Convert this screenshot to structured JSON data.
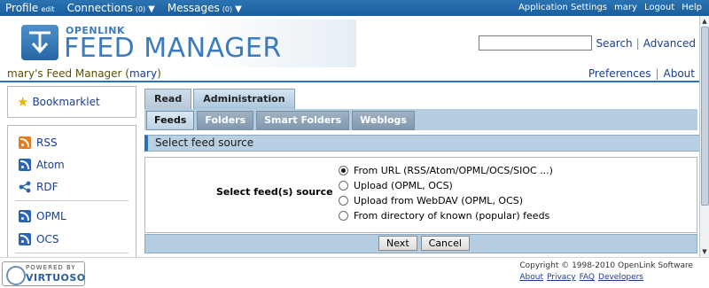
{
  "topbar": {
    "profile": "Profile",
    "profile_edit": "edit",
    "connections": "Connections",
    "connections_count": "(0)",
    "messages": "Messages",
    "messages_count": "(0)",
    "right_links": [
      "Application Settings",
      "mary",
      "Logout",
      "Help"
    ]
  },
  "header": {
    "logo_sub": "OPENLINK",
    "logo_title": "FEED MANAGER",
    "search_value": "",
    "search_label": "Search",
    "advanced_label": "Advanced"
  },
  "titleline": {
    "title": "mary's Feed Manager (",
    "user": "mary",
    "title_end": ")",
    "preferences": "Preferences",
    "about": "About"
  },
  "sidebar": {
    "bookmarklet": "Bookmarklet",
    "items": [
      {
        "label": "RSS",
        "icon": "rss-icon"
      },
      {
        "label": "Atom",
        "icon": "atom-icon"
      },
      {
        "label": "RDF",
        "icon": "rdf-icon"
      },
      {
        "label": "OPML",
        "icon": "opml-icon"
      },
      {
        "label": "OCS",
        "icon": "ocs-icon"
      }
    ]
  },
  "tabs": {
    "top": [
      "Read",
      "Administration"
    ],
    "top_active": "Administration",
    "sub": [
      "Feeds",
      "Folders",
      "Smart Folders",
      "Weblogs"
    ],
    "sub_active": "Feeds"
  },
  "section": {
    "title": "Select feed source",
    "form_label": "Select feed(s) source",
    "options": [
      "From URL (RSS/Atom/OPML/OCS/SIOC ...)",
      "Upload (OPML, OCS)",
      "Upload from WebDAV (OPML, OCS)",
      "From directory of known (popular) feeds"
    ],
    "selected_index": 0,
    "next_label": "Next",
    "cancel_label": "Cancel"
  },
  "footer": {
    "powered": "POWERED BY",
    "virtuoso": "VIRTUOSO",
    "copyright": "Copyright © 1998-2010 OpenLink Software",
    "links": [
      "About",
      "Privacy",
      "FAQ",
      "Developers"
    ]
  },
  "colors": {
    "topbar": "#1a5d9c",
    "accent": "#2a73b2",
    "tabbar": "#b5cde0"
  }
}
